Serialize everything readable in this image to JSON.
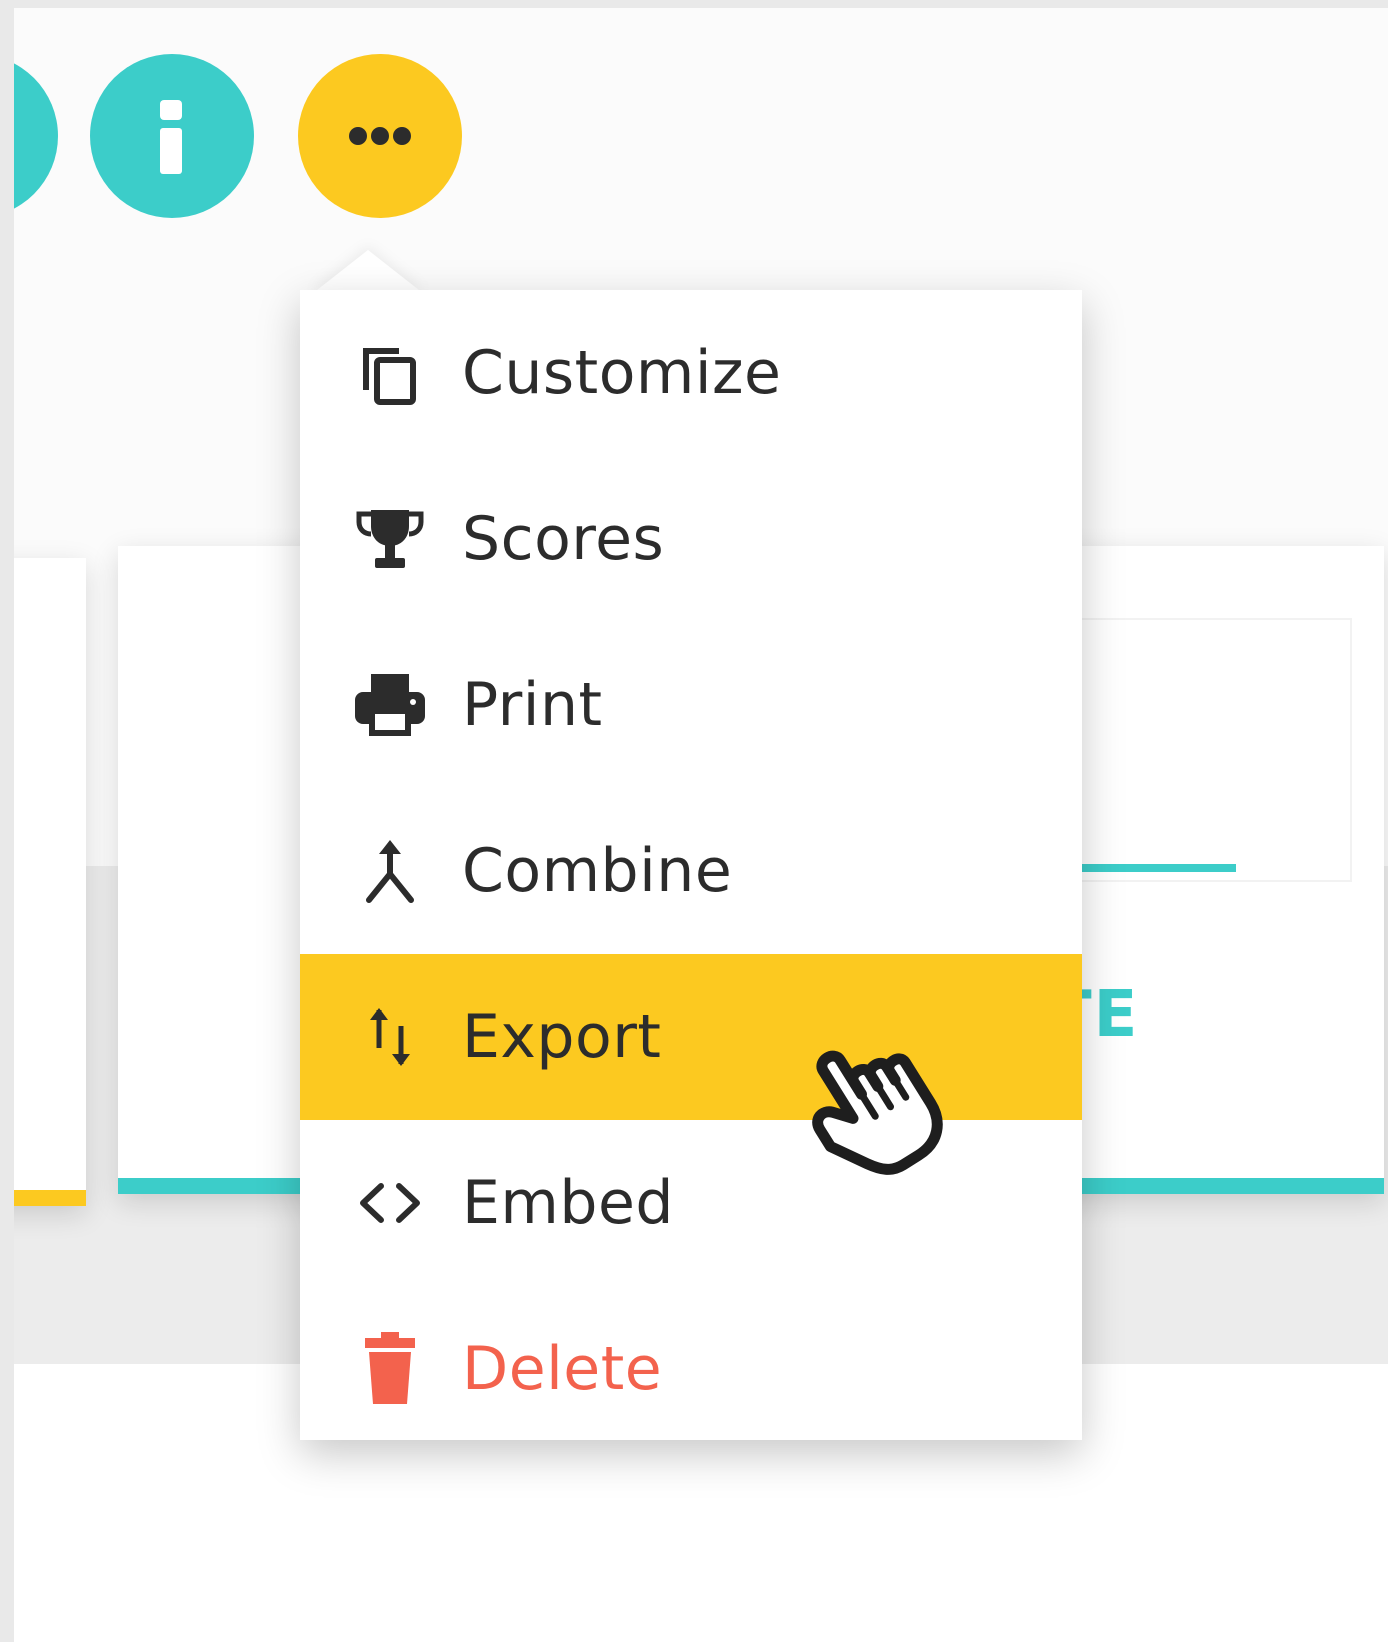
{
  "toolbar": {
    "info_button_icon": "info-icon",
    "more_button_icon": "more-horizontal-icon",
    "colors": {
      "teal": "#3ccdc9",
      "yellow": "#fcc920"
    }
  },
  "background_card": {
    "action_label": "TE",
    "glyph": "?"
  },
  "menu": {
    "items": [
      {
        "label": "Customize",
        "icon": "copy-icon"
      },
      {
        "label": "Scores",
        "icon": "trophy-icon"
      },
      {
        "label": "Print",
        "icon": "printer-icon"
      },
      {
        "label": "Combine",
        "icon": "merge-icon"
      },
      {
        "label": "Export",
        "icon": "export-arrows-icon",
        "active": true
      },
      {
        "label": "Embed",
        "icon": "code-icon"
      },
      {
        "label": "Delete",
        "icon": "trash-icon",
        "danger": true
      }
    ],
    "colors": {
      "highlight": "#fcc920",
      "text": "#2c2c2c",
      "danger": "#f3624d"
    }
  },
  "cursor": {
    "icon": "hand-pointer-icon"
  }
}
